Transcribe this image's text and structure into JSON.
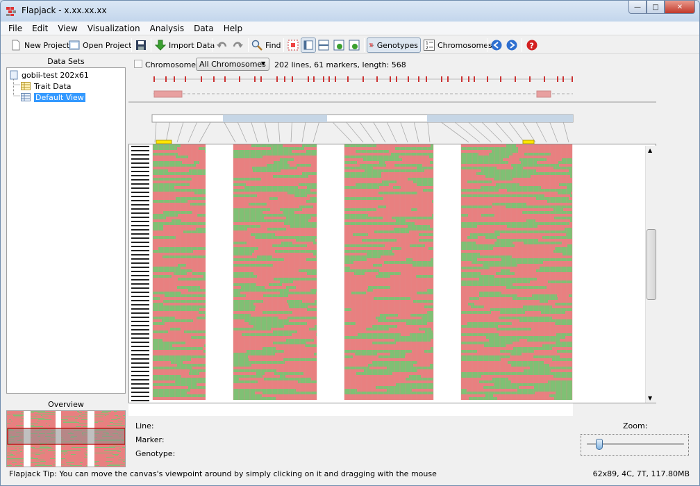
{
  "window": {
    "title": "Flapjack - x.xx.xx.xx"
  },
  "menu": [
    "File",
    "Edit",
    "View",
    "Visualization",
    "Analysis",
    "Data",
    "Help"
  ],
  "toolbar": {
    "new_project": "New Project",
    "open_project": "Open Project",
    "import_data": "Import Data",
    "find": "Find",
    "genotypes": "Genotypes",
    "chromosomes": "Chromosomes"
  },
  "left_panel": {
    "header": "Data Sets",
    "tree": [
      {
        "label": "gobii-test 202x61",
        "icon": "dataset-icon"
      },
      {
        "label": "Trait Data",
        "icon": "trait-table-icon"
      },
      {
        "label": "Default View",
        "icon": "view-table-icon",
        "selected": true
      }
    ],
    "overview_header": "Overview"
  },
  "main": {
    "chromosome_label": "Chromosome:",
    "chromosome_selected": "All Chromosomes",
    "summary": "202 lines, 61 markers, length: 568",
    "colors": {
      "allele_a": "#e88080",
      "allele_b": "#7fc074",
      "highlight": "#c6d6e6"
    }
  },
  "details": {
    "line_label": "Line:",
    "marker_label": "Marker:",
    "genotype_label": "Genotype:",
    "zoom_label": "Zoom:",
    "zoom_value": 0.1
  },
  "status": {
    "tip": "Flapjack Tip:  You can move the canvas's viewpoint around by simply clicking on it and dragging with the mouse",
    "memory": "62x89, 4C, 7T, 117.80MB"
  }
}
